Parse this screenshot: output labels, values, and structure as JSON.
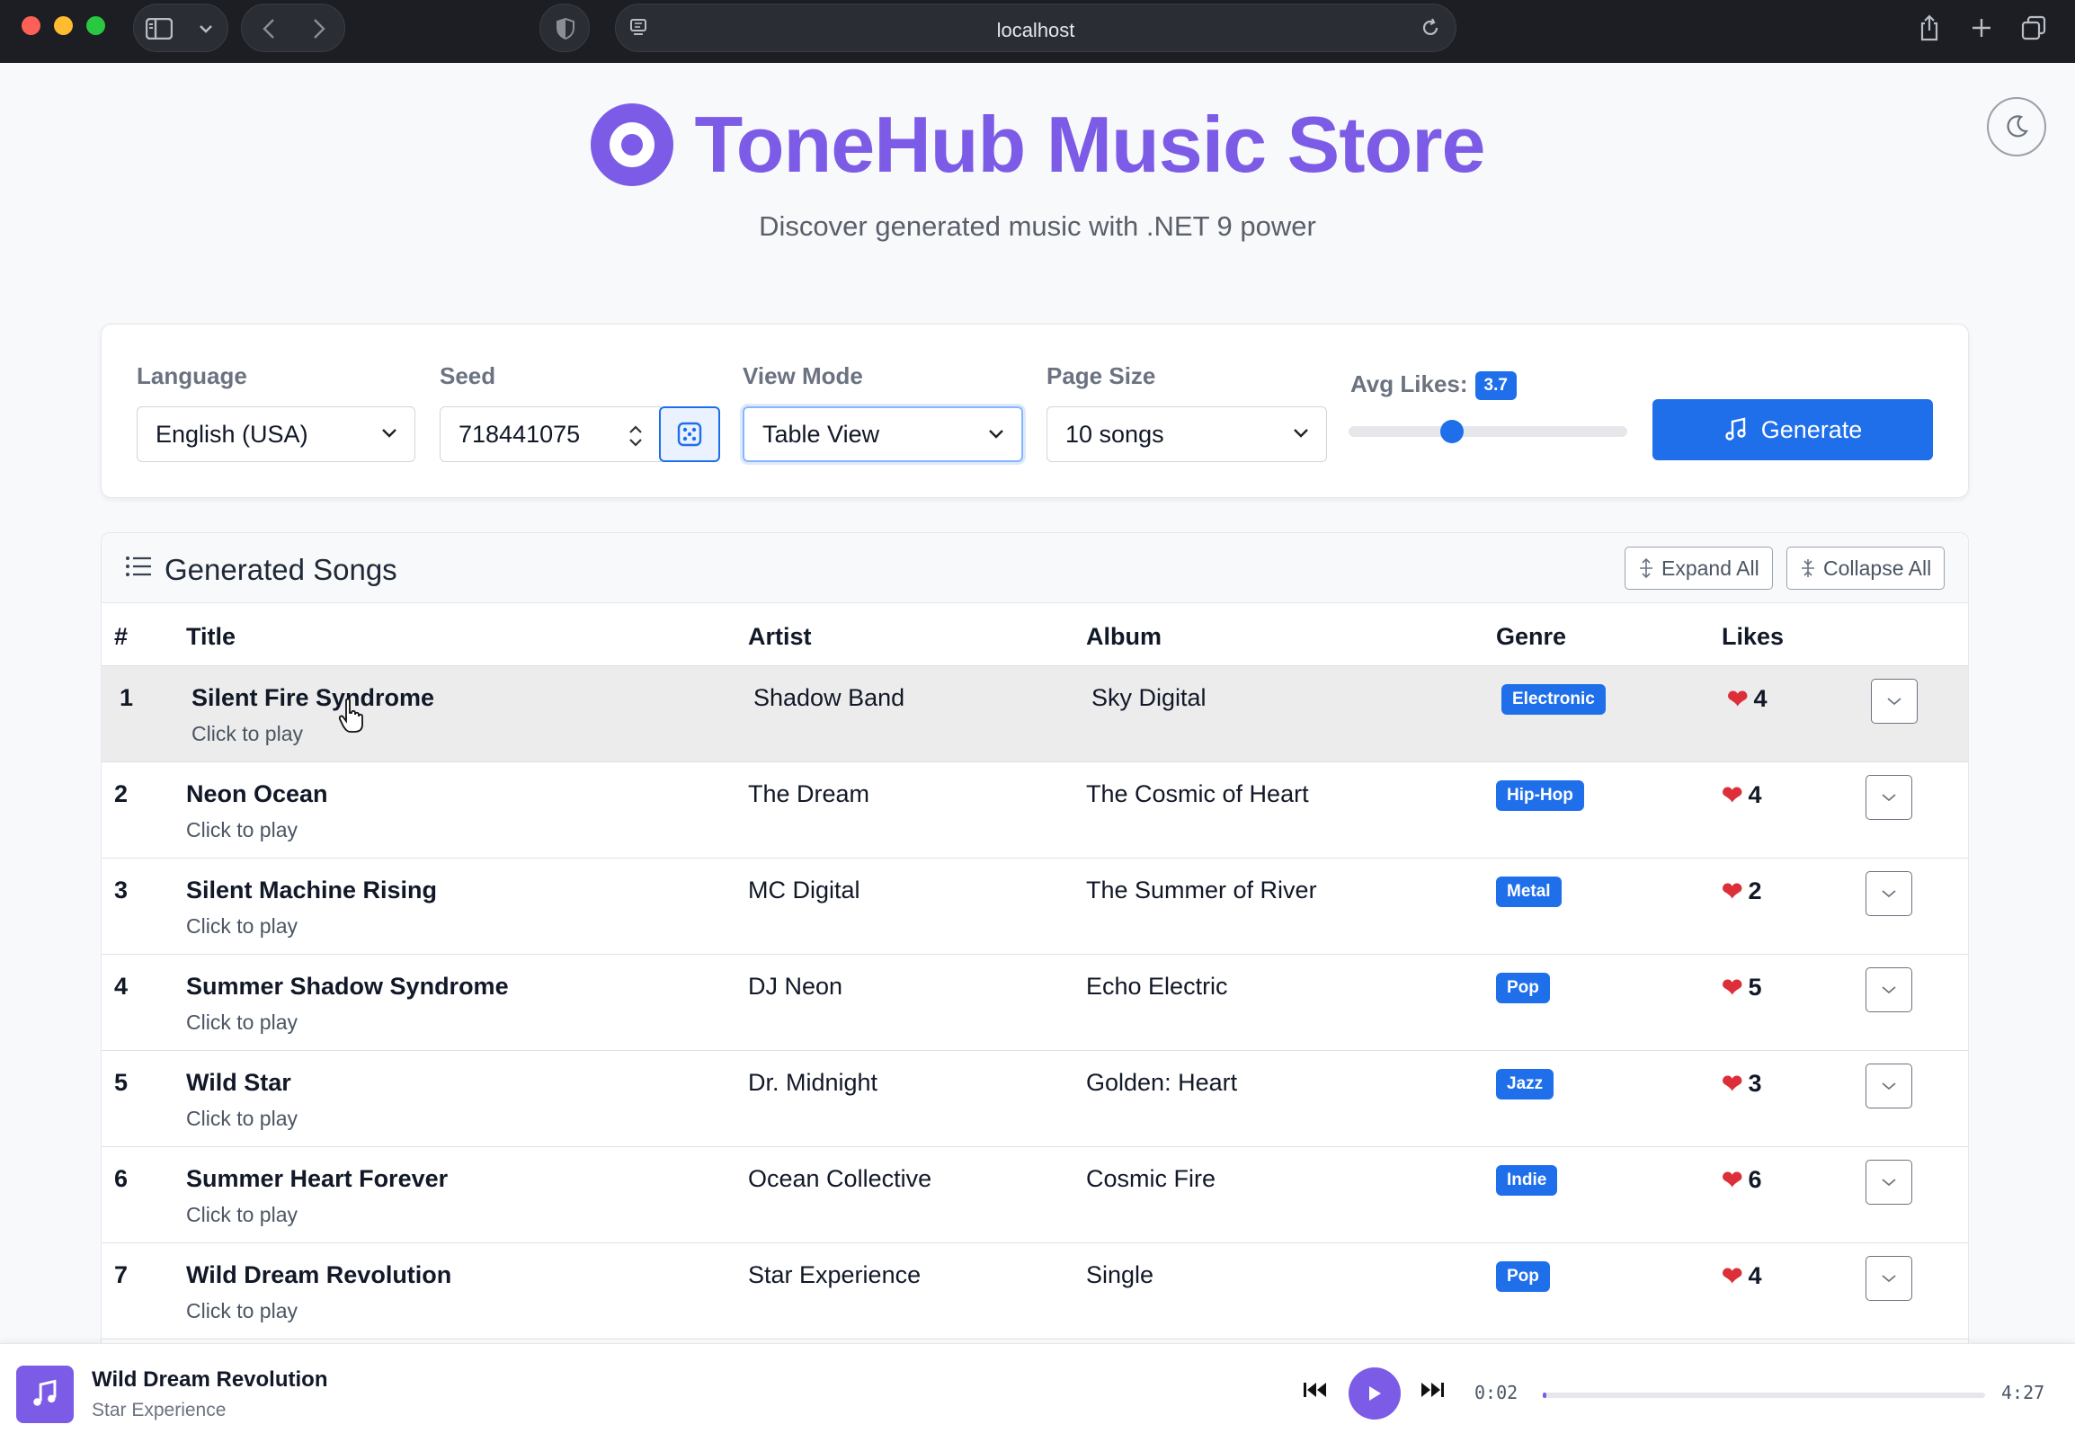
{
  "browser": {
    "url": "localhost"
  },
  "hero": {
    "title": "ToneHub Music Store",
    "subtitle": "Discover generated music with .NET 9 power"
  },
  "controls": {
    "language": {
      "label": "Language",
      "value": "English (USA)"
    },
    "seed": {
      "label": "Seed",
      "value": "718441075"
    },
    "view_mode": {
      "label": "View Mode",
      "value": "Table View"
    },
    "page_size": {
      "label": "Page Size",
      "value": "10 songs"
    },
    "avg_likes": {
      "label": "Avg Likes:",
      "value": "3.7",
      "fraction": 0.37
    },
    "generate_label": "Generate"
  },
  "songs": {
    "title": "Generated Songs",
    "expand_all": "Expand All",
    "collapse_all": "Collapse All",
    "columns": [
      "#",
      "Title",
      "Artist",
      "Album",
      "Genre",
      "Likes"
    ],
    "rows": [
      {
        "n": "1",
        "title": "Silent Fire Syndrome",
        "sub": "Click to play",
        "artist": "Shadow Band",
        "album": "Sky Digital",
        "genre": "Electronic",
        "likes": "4"
      },
      {
        "n": "2",
        "title": "Neon Ocean",
        "sub": "Click to play",
        "artist": "The Dream",
        "album": "The Cosmic of Heart",
        "genre": "Hip-Hop",
        "likes": "4"
      },
      {
        "n": "3",
        "title": "Silent Machine Rising",
        "sub": "Click to play",
        "artist": "MC Digital",
        "album": "The Summer of River",
        "genre": "Metal",
        "likes": "2"
      },
      {
        "n": "4",
        "title": "Summer Shadow Syndrome",
        "sub": "Click to play",
        "artist": "DJ Neon",
        "album": "Echo Electric",
        "genre": "Pop",
        "likes": "5"
      },
      {
        "n": "5",
        "title": "Wild Star",
        "sub": "Click to play",
        "artist": "Dr. Midnight",
        "album": "Golden: Heart",
        "genre": "Jazz",
        "likes": "3"
      },
      {
        "n": "6",
        "title": "Summer Heart Forever",
        "sub": "Click to play",
        "artist": "Ocean Collective",
        "album": "Cosmic Fire",
        "genre": "Indie",
        "likes": "6"
      },
      {
        "n": "7",
        "title": "Wild Dream Revolution",
        "sub": "Click to play",
        "artist": "Star Experience",
        "album": "Single",
        "genre": "Pop",
        "likes": "4"
      }
    ]
  },
  "player": {
    "title": "Wild Dream Revolution",
    "artist": "Star Experience",
    "elapsed": "0:02",
    "duration": "4:27",
    "progress_fraction": 0.008
  },
  "colors": {
    "brand": "#7c5ce6",
    "accent": "#1f6feb",
    "heart": "#dc2f3a"
  }
}
